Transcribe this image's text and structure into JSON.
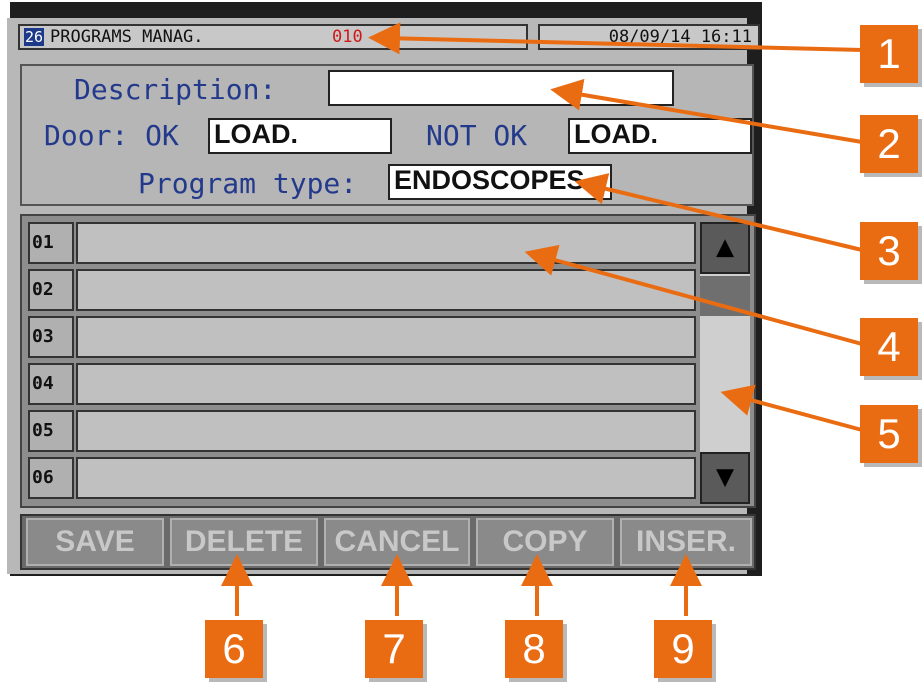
{
  "header": {
    "screen_number": "26",
    "title": "PROGRAMS MANAG.",
    "code": "010",
    "datetime": "08/09/14  16:11"
  },
  "form": {
    "description_label": "Description:",
    "description_value": "",
    "door_label": "Door: OK",
    "door_ok_value": "LOAD.",
    "not_ok_label": "NOT OK",
    "door_not_ok_value": "LOAD.",
    "program_type_label": "Program type:",
    "program_type_value": "ENDOSCOPES"
  },
  "list": {
    "rows": [
      "01",
      "02",
      "03",
      "04",
      "05",
      "06"
    ]
  },
  "scrollbar": {
    "up_icon": "triangle-up-icon",
    "down_icon": "triangle-down-icon"
  },
  "buttons": {
    "save": "SAVE",
    "delete": "DELETE",
    "cancel": "CANCEL",
    "copy": "COPY",
    "insert": "INSER."
  },
  "callouts": [
    "1",
    "2",
    "3",
    "4",
    "5",
    "6",
    "7",
    "8",
    "9"
  ],
  "colors": {
    "callout": "#ea6c12",
    "label_blue": "#233a8c",
    "code_red": "#d01818"
  }
}
